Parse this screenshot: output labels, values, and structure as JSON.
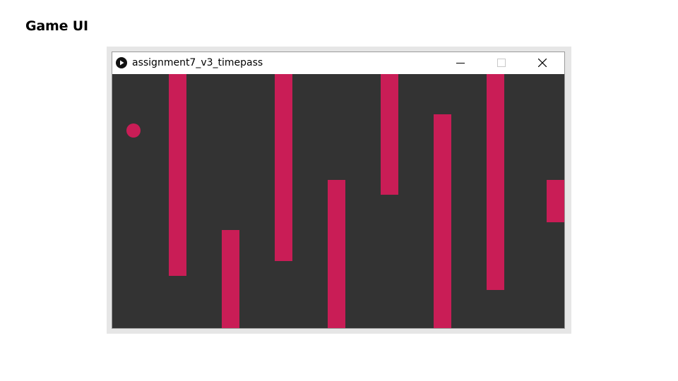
{
  "slide": {
    "title": "Game UI"
  },
  "window": {
    "title": "assignment7_v3_timepass",
    "app_icon": "play-icon",
    "controls": {
      "minimize_icon": "minimize-icon",
      "maximize_icon": "maximize-icon",
      "close_icon": "close-icon"
    }
  },
  "game": {
    "background_color": "#333333",
    "obstacle_color": "#c91d56",
    "player_color": "#c91d56",
    "player": {
      "shape": "circle"
    },
    "obstacles": [
      {
        "anchor": "top"
      },
      {
        "anchor": "bottom"
      },
      {
        "anchor": "top"
      },
      {
        "anchor": "bottom"
      },
      {
        "anchor": "top"
      },
      {
        "anchor": "bottom"
      },
      {
        "anchor": "top"
      },
      {
        "anchor": "floating"
      }
    ]
  }
}
